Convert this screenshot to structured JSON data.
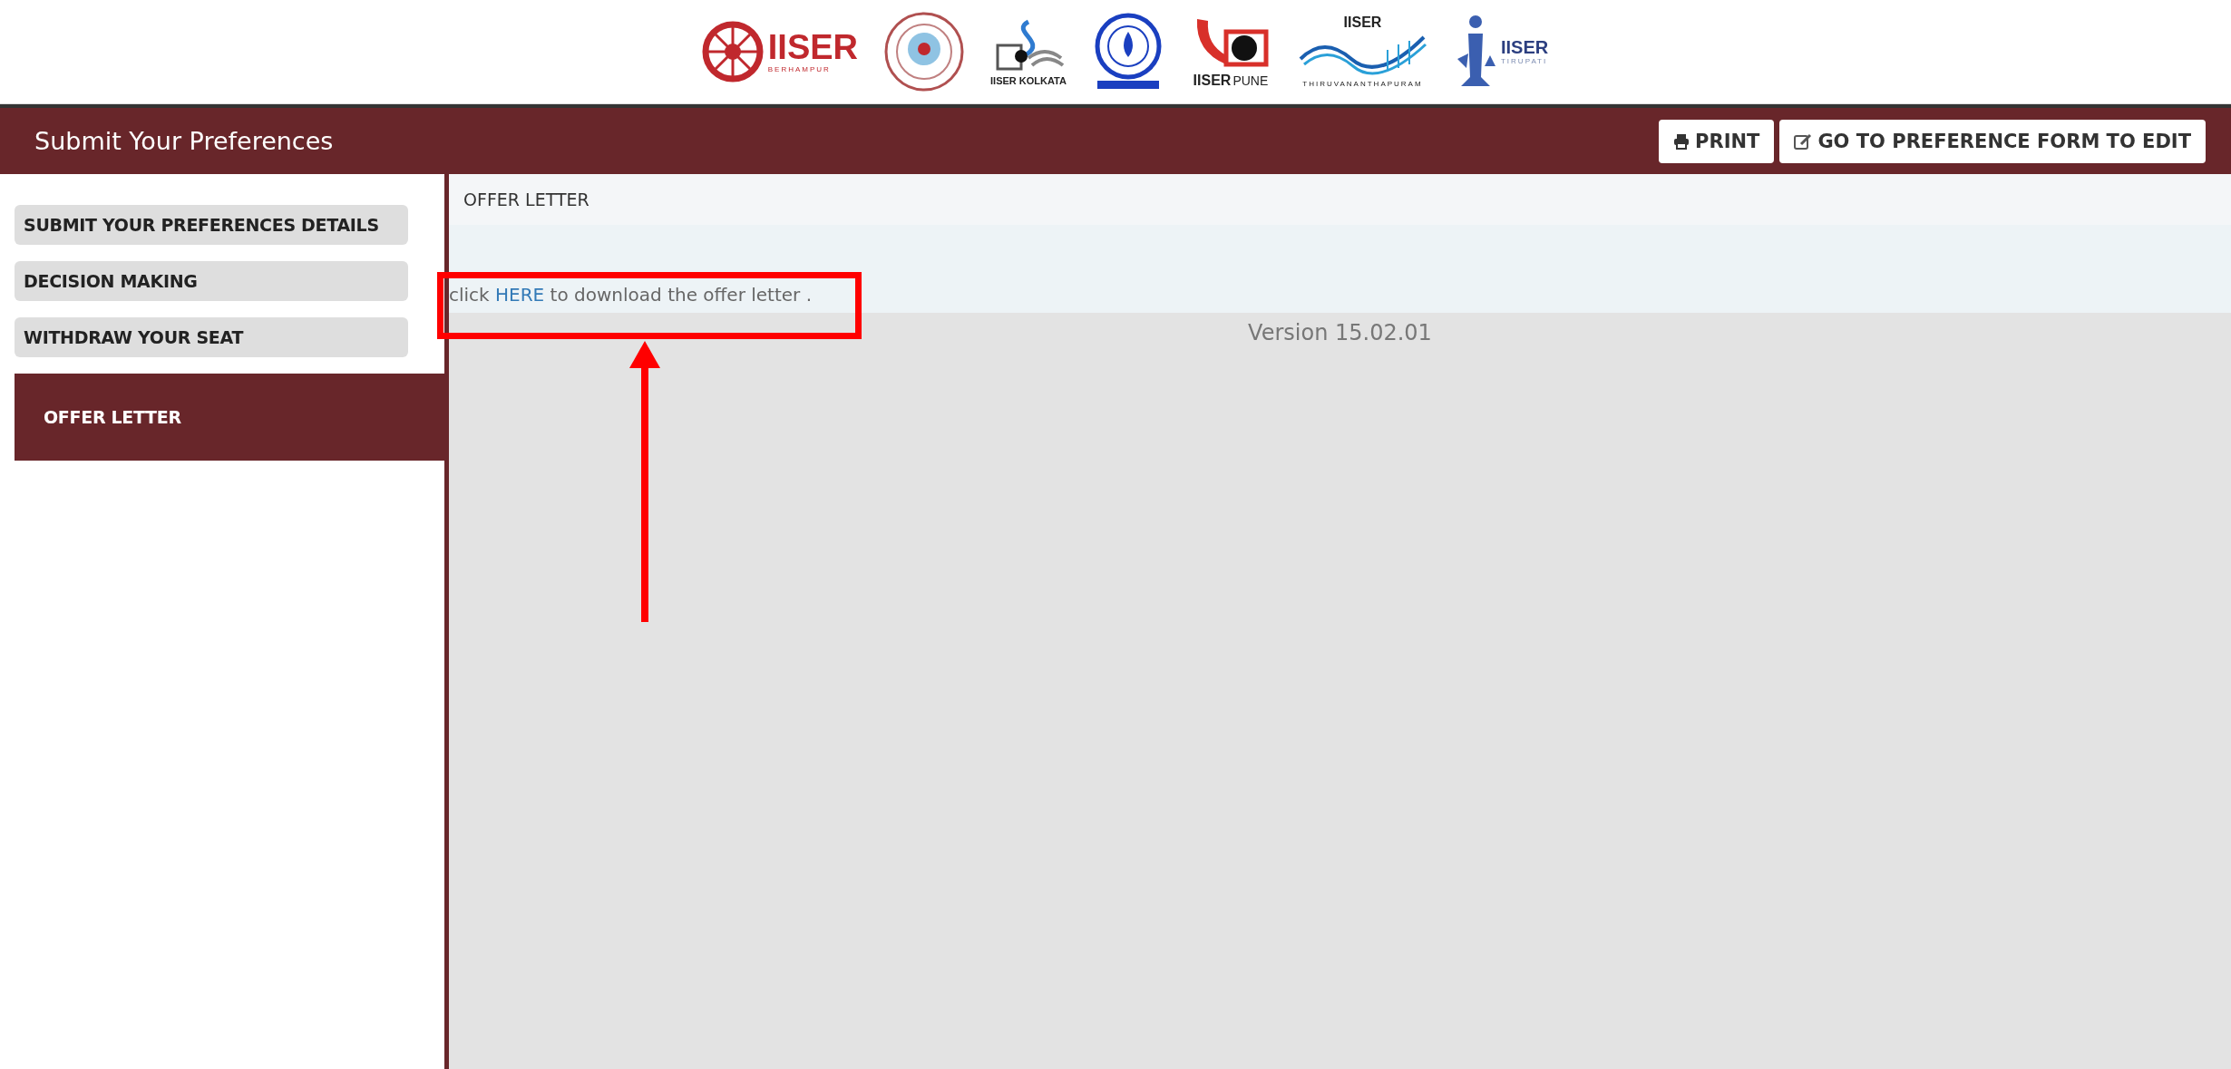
{
  "logos": [
    {
      "kind": "wheel",
      "text": "IISER",
      "subtext": "BERHAMPUR"
    },
    {
      "kind": "seal-round"
    },
    {
      "kind": "helix",
      "text": "IISER KOLKATA"
    },
    {
      "kind": "seal-blue"
    },
    {
      "kind": "pune",
      "text": "IISER",
      "subtext": "PUNE"
    },
    {
      "kind": "wave",
      "text": "IISER",
      "subtext": "THIRUVANANTHAPURAM"
    },
    {
      "kind": "tirupati",
      "text": "IISER",
      "subtext": "TIRUPATI"
    }
  ],
  "top_bar": {
    "title": "Submit Your Preferences",
    "buttons": [
      {
        "kind": "print",
        "label": "PRINT"
      },
      {
        "kind": "edit",
        "label": "GO TO PREFERENCE FORM TO EDIT"
      }
    ]
  },
  "sidebar": {
    "items": [
      {
        "label": "SUBMIT YOUR PREFERENCES DETAILS",
        "selected": false
      },
      {
        "label": "DECISION MAKING",
        "selected": false
      },
      {
        "label": "WITHDRAW YOUR SEAT",
        "selected": false
      },
      {
        "label": "OFFER LETTER",
        "selected": true
      }
    ]
  },
  "panel": {
    "title": "OFFER LETTER",
    "message": {
      "before": "click ",
      "link": "HERE",
      "after": " to download the offer letter ."
    }
  },
  "version": "Version 15.02.01",
  "annotation": {
    "kind": "box-and-arrow"
  }
}
